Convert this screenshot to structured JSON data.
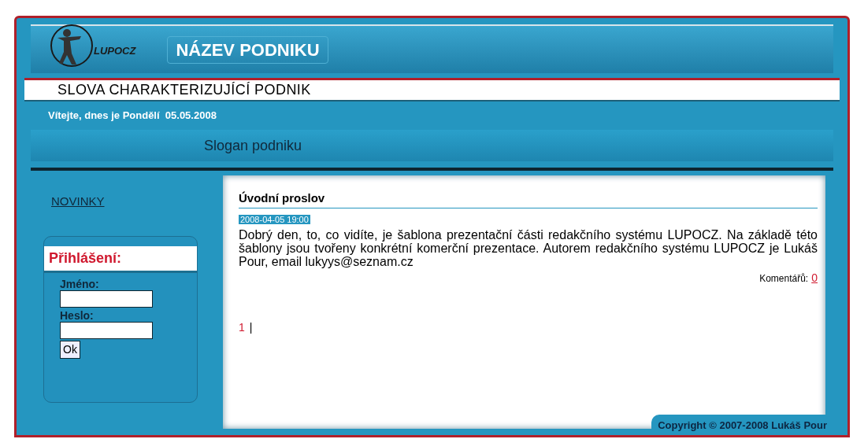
{
  "header": {
    "logo_text": "LUPOCZ",
    "company_name": "NÁZEV PODNIKU",
    "tagline": "SLOVA CHARAKTERIZUJÍCÍ PODNIK",
    "welcome": "Vítejte, dnes je Pondělí  05.05.2008",
    "slogan": "Slogan podniku"
  },
  "sidebar": {
    "menu": [
      {
        "label": "NOVINKY"
      }
    ],
    "login": {
      "title": "Přihlášení:",
      "fields": [
        {
          "label": "Jméno:"
        },
        {
          "label": "Heslo:"
        }
      ],
      "button": "Ok"
    }
  },
  "article": {
    "title": "Úvodní proslov",
    "date": "2008-04-05 19:00",
    "body": "Dobrý den, to, co vidíte, je šablona prezentační části redakčního systému LUPOCZ. Na základě této šablony jsou tvořeny konkrétní komerční prezentace. Autorem redakčního systému LUPOCZ je Lukáš Pour, email lukyys@seznam.cz",
    "comments_label": "Komentářů:",
    "comments_count": "0"
  },
  "pagination": {
    "pages": [
      {
        "label": "1"
      }
    ],
    "separator": "|"
  },
  "footer": {
    "copyright": "Copyright © 2007-2008 Lukáš Pour"
  }
}
